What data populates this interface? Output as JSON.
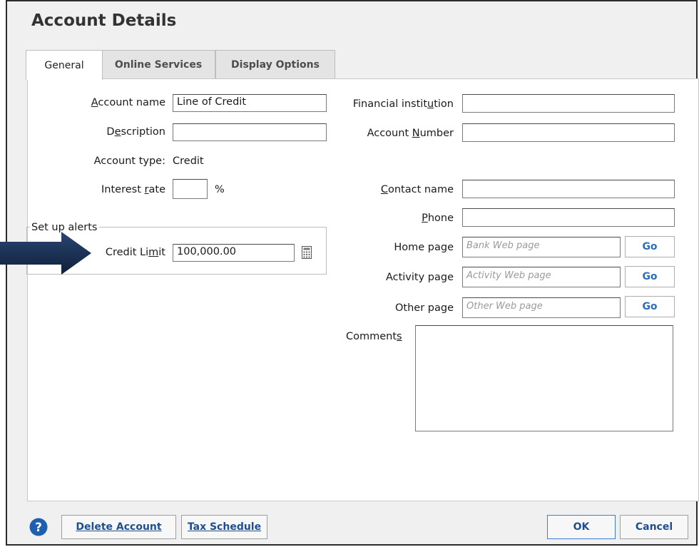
{
  "dialog": {
    "title": "Account Details"
  },
  "tabs": [
    {
      "label": "General",
      "active": true
    },
    {
      "label": "Online Services",
      "active": false
    },
    {
      "label": "Display Options",
      "active": false
    }
  ],
  "left": {
    "account_name": {
      "label": "Account name",
      "value": "Line of Credit"
    },
    "description": {
      "label": "Description",
      "value": ""
    },
    "account_type": {
      "label": "Account type:",
      "value": "Credit"
    },
    "interest_rate": {
      "label": "Interest rate",
      "value": "",
      "unit": "%"
    },
    "alerts": {
      "group_label": "Set up alerts",
      "credit_limit": {
        "label": "Credit Limit",
        "value": "100,000.00"
      }
    }
  },
  "right": {
    "financial_institution": {
      "label": "Financial institution",
      "value": ""
    },
    "account_number": {
      "label": "Account Number",
      "value": ""
    },
    "contact_name": {
      "label": "Contact name",
      "value": ""
    },
    "phone": {
      "label": "Phone",
      "value": ""
    },
    "home_page": {
      "label": "Home page",
      "placeholder": "Bank Web page",
      "go": "Go"
    },
    "activity_page": {
      "label": "Activity page",
      "placeholder": "Activity Web page",
      "go": "Go"
    },
    "other_page": {
      "label": "Other page",
      "placeholder": "Other Web page",
      "go": "Go"
    },
    "comments": {
      "label": "Comments",
      "value": ""
    }
  },
  "footer": {
    "help_icon": "question-mark",
    "delete_account": "Delete Account",
    "tax_schedule": "Tax Schedule",
    "ok": "OK",
    "cancel": "Cancel"
  },
  "colors": {
    "accent_blue": "#1f5fb0",
    "arrow": "#152a4a",
    "button_text": "#1f4f8f"
  }
}
